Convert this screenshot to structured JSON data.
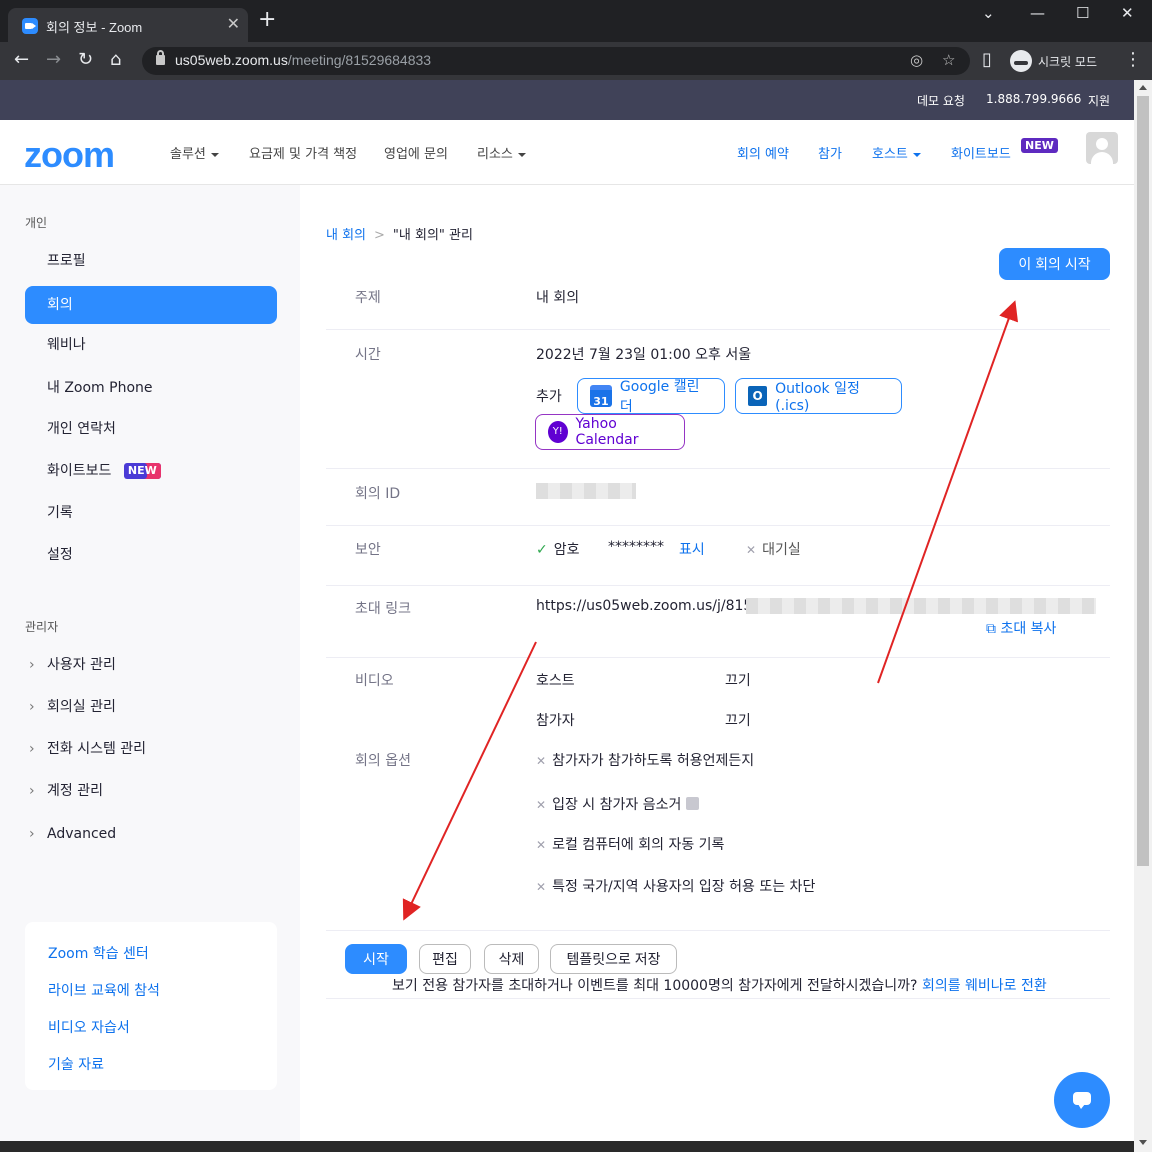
{
  "browser": {
    "tab_title": "회의 정보 - Zoom",
    "url_host": "us05web.zoom.us",
    "url_path": "/meeting/81529684833",
    "incognito_label": "시크릿 모드"
  },
  "topstrip": {
    "demo": "데모 요청",
    "phone": "1.888.799.9666",
    "support": "지원"
  },
  "header": {
    "logo": "zoom",
    "nav_left": [
      "솔루션",
      "요금제 및 가격 책정",
      "영업에 문의",
      "리소스"
    ],
    "schedule": "회의 예약",
    "join": "참가",
    "host": "호스트",
    "whiteboard": "화이트보드",
    "new_badge": "NEW"
  },
  "sidebar": {
    "personal_label": "개인",
    "items": [
      "프로필",
      "회의",
      "웨비나",
      "내 Zoom Phone",
      "개인 연락처",
      "화이트보드",
      "기록",
      "설정"
    ],
    "whiteboard_badge": "NEW",
    "admin_label": "관리자",
    "admin_items": [
      "사용자 관리",
      "회의실 관리",
      "전화 시스템 관리",
      "계정 관리",
      "Advanced"
    ],
    "learn_links": [
      "Zoom 학습 센터",
      "라이브 교육에 참석",
      "비디오 자습서",
      "기술 자료"
    ]
  },
  "main": {
    "breadcrumb_link": "내 회의",
    "breadcrumb_sep": ">",
    "breadcrumb_current": "\"내 회의\" 관리",
    "start_meeting": "이 회의 시작",
    "topic_label": "주제",
    "topic_value": "내 회의",
    "time_label": "시간",
    "time_value": "2022년 7월 23일 01:00 오후 서울",
    "add_label": "추가",
    "gcal_icon": "31",
    "gcal": "Google 캘린더",
    "outlook_icon": "O",
    "outlook": "Outlook 일정(.ics)",
    "yahoo_icon": "Y!",
    "yahoo": "Yahoo Calendar",
    "meeting_id_label": "회의 ID",
    "security_label": "보안",
    "passcode_label": "암호",
    "passcode_value": "********",
    "show": "표시",
    "waiting_room": "대기실",
    "invite_label": "초대 링크",
    "invite_value": "https://us05web.zoom.us/j/81529",
    "copy_invite": "초대 복사",
    "video_label": "비디오",
    "video_host": "호스트",
    "video_host_value": "끄기",
    "video_participant": "참가자",
    "video_participant_value": "끄기",
    "options_label": "회의 옵션",
    "options": [
      "참가자가 참가하도록 허용언제든지",
      "입장 시 참가자 음소거",
      "로컬 컴퓨터에 회의 자동 기록",
      "특정 국가/지역 사용자의 입장 허용 또는 차단"
    ],
    "btn_start": "시작",
    "btn_edit": "편집",
    "btn_delete": "삭제",
    "btn_template": "템플릿으로 저장",
    "webinar_note": "보기 전용 참가자를 초대하거나 이벤트를 최대 10000명의 참가자에게 전달하시겠습니까?",
    "webinar_link": "회의를 웨비나로 전환"
  },
  "colors": {
    "accent": "#2d8cff",
    "link": "#0e72ed",
    "arrow": "#e02424"
  }
}
